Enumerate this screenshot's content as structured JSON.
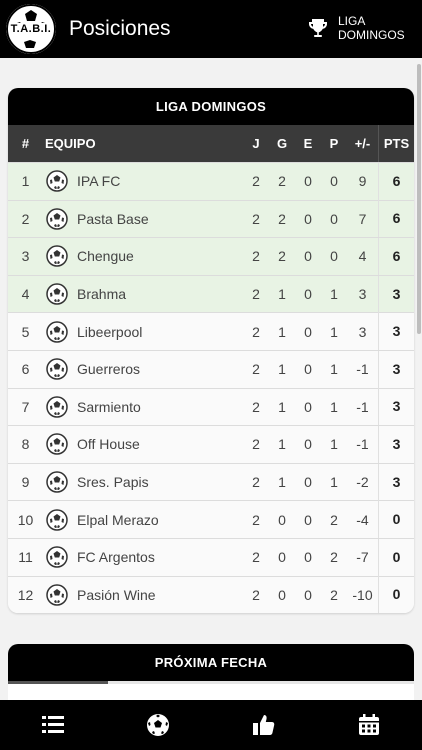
{
  "header": {
    "logo_text": "T.A.B.I.",
    "title": "Posiciones",
    "league_line1": "LIGA",
    "league_line2": "DOMINGOS"
  },
  "table": {
    "title": "LIGA DOMINGOS",
    "columns": {
      "pos": "#",
      "team": "EQUIPO",
      "j": "J",
      "g": "G",
      "e": "E",
      "p": "P",
      "dif": "+/-",
      "pts": "PTS"
    },
    "rows": [
      {
        "pos": "1",
        "team": "IPA FC",
        "j": "2",
        "g": "2",
        "e": "0",
        "p": "0",
        "dif": "9",
        "pts": "6"
      },
      {
        "pos": "2",
        "team": "Pasta Base",
        "j": "2",
        "g": "2",
        "e": "0",
        "p": "0",
        "dif": "7",
        "pts": "6"
      },
      {
        "pos": "3",
        "team": "Chengue",
        "j": "2",
        "g": "2",
        "e": "0",
        "p": "0",
        "dif": "4",
        "pts": "6"
      },
      {
        "pos": "4",
        "team": "Brahma",
        "j": "2",
        "g": "1",
        "e": "0",
        "p": "1",
        "dif": "3",
        "pts": "3"
      },
      {
        "pos": "5",
        "team": "Libeerpool",
        "j": "2",
        "g": "1",
        "e": "0",
        "p": "1",
        "dif": "3",
        "pts": "3"
      },
      {
        "pos": "6",
        "team": "Guerreros",
        "j": "2",
        "g": "1",
        "e": "0",
        "p": "1",
        "dif": "-1",
        "pts": "3"
      },
      {
        "pos": "7",
        "team": "Sarmiento",
        "j": "2",
        "g": "1",
        "e": "0",
        "p": "1",
        "dif": "-1",
        "pts": "3"
      },
      {
        "pos": "8",
        "team": "Off House",
        "j": "2",
        "g": "1",
        "e": "0",
        "p": "1",
        "dif": "-1",
        "pts": "3"
      },
      {
        "pos": "9",
        "team": "Sres. Papis",
        "j": "2",
        "g": "1",
        "e": "0",
        "p": "1",
        "dif": "-2",
        "pts": "3"
      },
      {
        "pos": "10",
        "team": "Elpal Merazo",
        "j": "2",
        "g": "0",
        "e": "0",
        "p": "2",
        "dif": "-4",
        "pts": "0"
      },
      {
        "pos": "11",
        "team": "FC Argentos",
        "j": "2",
        "g": "0",
        "e": "0",
        "p": "2",
        "dif": "-7",
        "pts": "0"
      },
      {
        "pos": "12",
        "team": "Pasión Wine",
        "j": "2",
        "g": "0",
        "e": "0",
        "p": "2",
        "dif": "-10",
        "pts": "0"
      }
    ]
  },
  "next": {
    "title": "PRÓXIMA FECHA"
  },
  "nav": {
    "items": [
      "list-icon",
      "soccer-ball-icon",
      "thumbs-up-icon",
      "calendar-icon"
    ]
  },
  "colors": {
    "header_bg": "#000000",
    "qualify_row": "#e8f3e4",
    "table_head": "#3a3a3a"
  }
}
